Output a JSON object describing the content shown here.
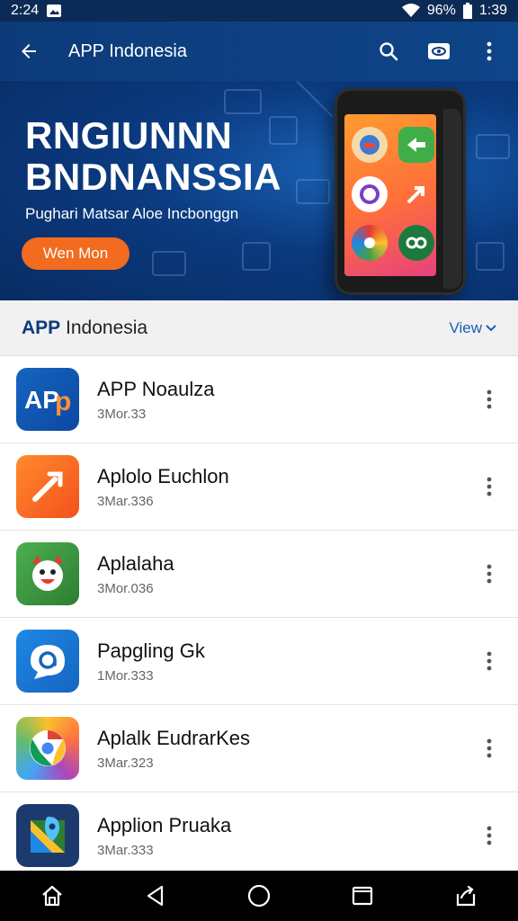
{
  "status_bar": {
    "time_left": "2:24",
    "signal": "96%",
    "time_right": "1:39"
  },
  "app_bar": {
    "title": "APP Indonesia"
  },
  "banner": {
    "title_line1": "RNGIUNNN",
    "title_line2": "BNDNANSSIA",
    "subtitle": "Pughari Matsar Aloe Incbonggn",
    "button_label": "Wen Mon"
  },
  "section": {
    "title_bold": "APP",
    "title_rest": " Indonesia",
    "view_label": "View"
  },
  "apps": [
    {
      "name": "APP Noaulza",
      "sub": "3Mor.33",
      "icon": "app-logo-icon"
    },
    {
      "name": "Aplolo Euchlon",
      "sub": "3Mar.336",
      "icon": "rocket-icon"
    },
    {
      "name": "Aplalaha",
      "sub": "3Mor.036",
      "icon": "smiley-face-icon"
    },
    {
      "name": "Papgling Gk",
      "sub": "1Mor.333",
      "icon": "chat-at-icon"
    },
    {
      "name": "Aplalk EudrarKes",
      "sub": "3Mar.323",
      "icon": "chrome-icon"
    },
    {
      "name": "Applion Pruaka",
      "sub": "3Mar.333",
      "icon": "maps-icon"
    }
  ],
  "colors": {
    "primary": "#0d3b7a",
    "accent": "#f26b1f",
    "link": "#1a5fb4"
  }
}
